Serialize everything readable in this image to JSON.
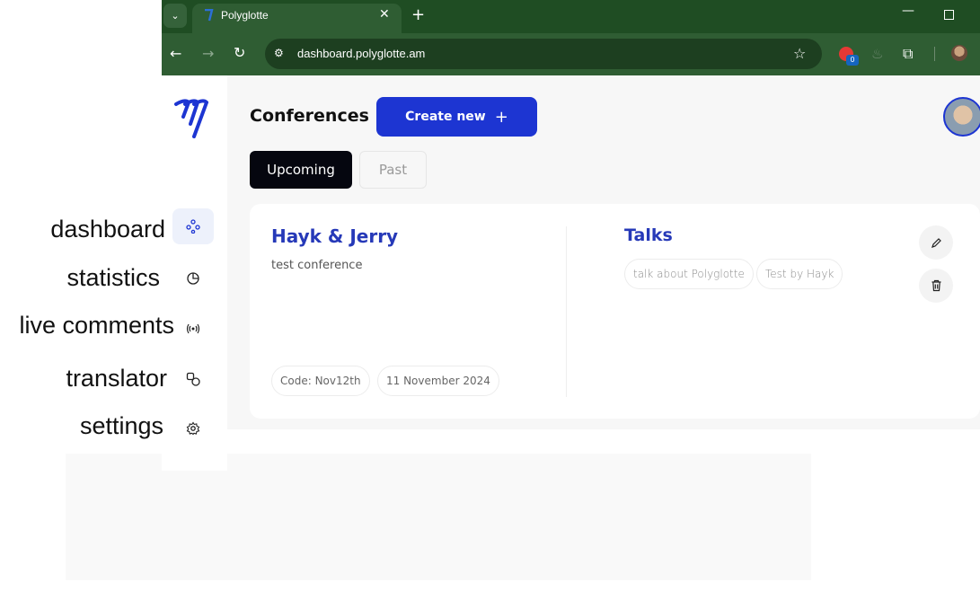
{
  "browser": {
    "tab_title": "Polyglotte",
    "url": "dashboard.polyglotte.am",
    "extension_badge": "0"
  },
  "sidebar": {
    "items": [
      {
        "label": "dashboard",
        "icon": "dashboard-icon",
        "active": true
      },
      {
        "label": "statistics",
        "icon": "pie-chart-icon",
        "active": false
      },
      {
        "label": "live comments",
        "icon": "broadcast-icon",
        "active": false
      },
      {
        "label": "translator",
        "icon": "translate-icon",
        "active": false
      },
      {
        "label": "settings",
        "icon": "gear-icon",
        "active": false
      }
    ]
  },
  "header": {
    "title": "Conferences",
    "create_label": "Create new",
    "create_icon": "+"
  },
  "tabs": {
    "upcoming": "Upcoming",
    "past": "Past"
  },
  "conference": {
    "title": "Hayk & Jerry",
    "description": "test conference",
    "code": "Code: Nov12th",
    "date": "11 November 2024",
    "talks_title": "Talks",
    "talks": [
      "talk about Polyglotte",
      "Test by Hayk"
    ]
  },
  "colors": {
    "accent": "#1d35d2",
    "title_blue": "#2639b8",
    "browser_green": "#2f5d33"
  }
}
